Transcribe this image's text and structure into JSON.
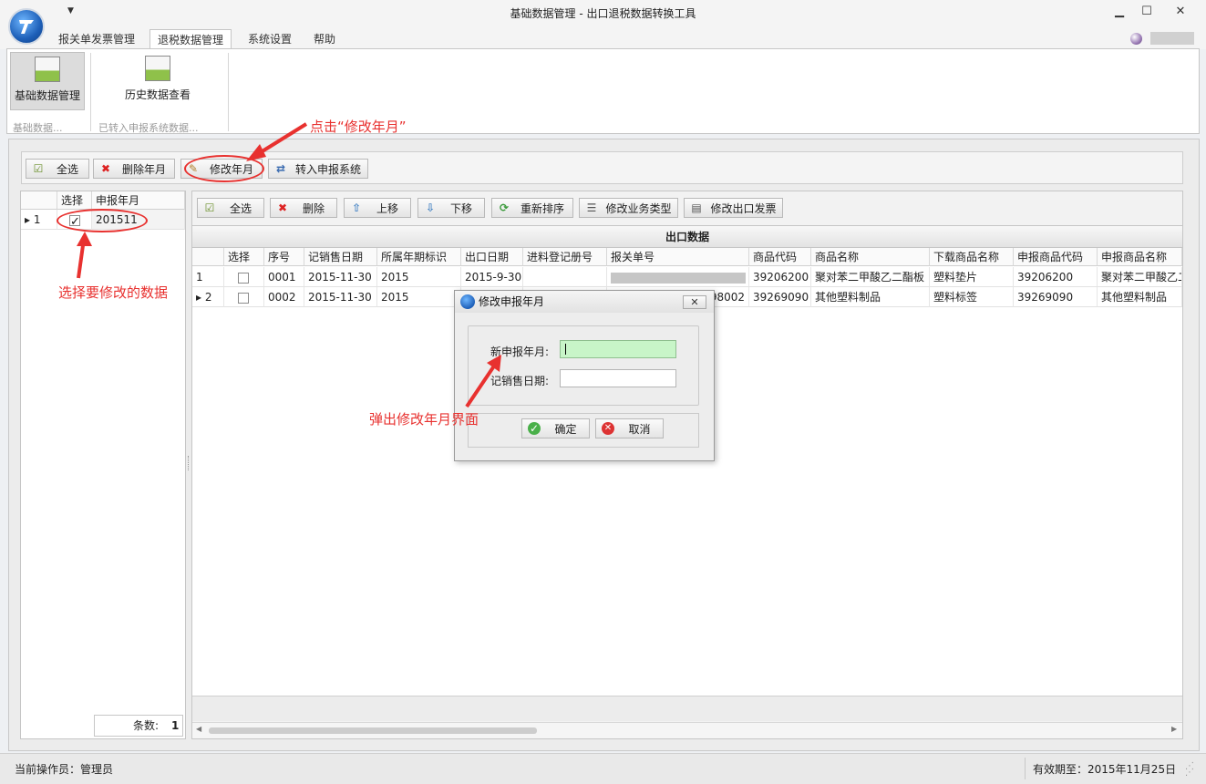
{
  "window": {
    "title": "基础数据管理 - 出口退税数据转换工具",
    "minimize": "▁",
    "maximize": "☐",
    "close": "✕"
  },
  "ribbon": {
    "tabs": [
      "报关单发票管理",
      "退税数据管理",
      "系统设置",
      "帮助"
    ],
    "active_tab": "退税数据管理",
    "buttons": [
      {
        "label": "基础数据管理",
        "icon": "table-icon",
        "selected": true
      },
      {
        "label": "历史数据查看",
        "icon": "table-icon",
        "selected": false
      }
    ],
    "groups": [
      "基础数据...",
      "已转入申报系统数据..."
    ]
  },
  "toolbar_top": {
    "select_all": "全选",
    "delete_month": "删除年月",
    "modify_month": "修改年月",
    "transfer": "转入申报系统"
  },
  "left_grid": {
    "headers": [
      "选择",
      "申报年月"
    ],
    "rows": [
      {
        "num": "1",
        "checked": true,
        "month": "201511"
      }
    ],
    "count_label": "条数:",
    "count_value": "1"
  },
  "toolbar_grid": {
    "select_all": "全选",
    "delete": "删除",
    "move_up": "上移",
    "move_down": "下移",
    "resort": "重新排序",
    "modify_type": "修改业务类型",
    "modify_invoice": "修改出口发票"
  },
  "export_grid": {
    "title": "出口数据",
    "headers": [
      "选择",
      "序号",
      "记销售日期",
      "所属年期标识",
      "出口日期",
      "进料登记册号",
      "报关单号",
      "商品代码",
      "商品名称",
      "下载商品名称",
      "申报商品代码",
      "申报商品名称"
    ],
    "rows": [
      {
        "num": "1",
        "seq": "0001",
        "sale_date": "2015-11-30",
        "period": "2015",
        "export_date": "2015-9-30",
        "reg_no": "",
        "customs_no": "",
        "code": "39206200",
        "name": "聚对苯二甲酸乙二酯板",
        "dl_name": "塑料垫片",
        "decl_code": "39206200",
        "decl_name": "聚对苯二甲酸乙二"
      },
      {
        "num": "2",
        "seq": "0002",
        "sale_date": "2015-11-30",
        "period": "2015",
        "export_date": "",
        "reg_no": "",
        "customs_no": "98002",
        "code": "39269090",
        "name": "其他塑料制品",
        "dl_name": "塑料标签",
        "decl_code": "39269090",
        "decl_name": "其他塑料制品"
      }
    ]
  },
  "dialog": {
    "title": "修改申报年月",
    "new_month_label": "新申报年月:",
    "sale_date_label": "记销售日期:",
    "new_month_value": "",
    "sale_date_value": "",
    "ok": "确定",
    "cancel": "取消",
    "close": "✕"
  },
  "annotations": {
    "click_modify": "点击“修改年月”",
    "select_data": "选择要修改的数据",
    "popup": "弹出修改年月界面"
  },
  "status": {
    "operator": "当前操作员：管理员",
    "valid_until": "有效期至：2015年11月25日"
  },
  "colors": {
    "annotation": "#e8312f",
    "focus_field": "#c8f5c8"
  }
}
